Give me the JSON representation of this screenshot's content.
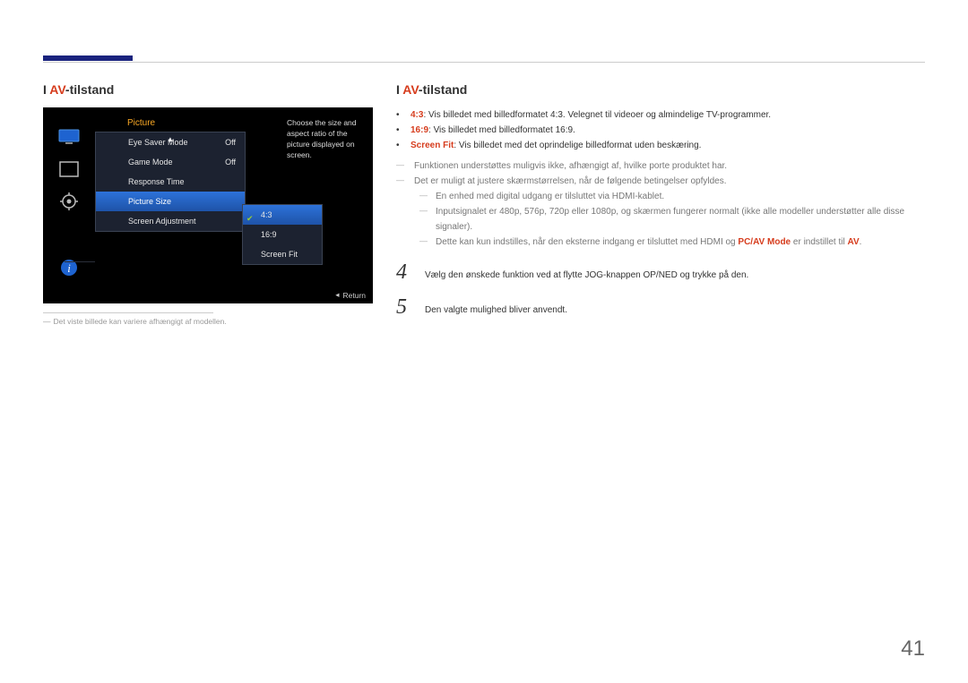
{
  "page_number": "41",
  "left": {
    "title_prefix": "I ",
    "title_accent": "AV",
    "title_suffix": "-tilstand",
    "caption": "Det viste billede kan variere afhængigt af modellen."
  },
  "osd": {
    "title": "Picture",
    "right_help": "Choose the size and aspect ratio of the picture displayed on screen.",
    "rows": [
      {
        "label": "Eye Saver Mode",
        "value": "Off"
      },
      {
        "label": "Game Mode",
        "value": "Off"
      },
      {
        "label": "Response Time",
        "value": ""
      },
      {
        "label": "Picture Size",
        "value": ""
      },
      {
        "label": "Screen Adjustment",
        "value": ""
      }
    ],
    "submenu": [
      {
        "label": "4:3",
        "selected": true
      },
      {
        "label": "16:9",
        "selected": false
      },
      {
        "label": "Screen Fit",
        "selected": false
      }
    ],
    "footer_return": "Return"
  },
  "right": {
    "title_prefix": "I ",
    "title_accent": "AV",
    "title_suffix": "-tilstand",
    "bullets": [
      {
        "label": "4:3",
        "desc": ": Vis billedet med billedformatet 4:3. Velegnet til videoer og almindelige TV-programmer."
      },
      {
        "label": "16:9",
        "desc": ": Vis billedet med billedformatet 16:9."
      },
      {
        "label": "Screen Fit",
        "desc": ": Vis billedet med det oprindelige billedformat uden beskæring."
      }
    ],
    "notes": {
      "n1": "Funktionen understøttes muligvis ikke, afhængigt af, hvilke porte produktet har.",
      "n2": "Det er muligt at justere skærmstørrelsen, når de følgende betingelser opfyldes.",
      "n2a": "En enhed med digital udgang er tilsluttet via HDMI-kablet.",
      "n2b": "Inputsignalet er 480p, 576p, 720p eller 1080p, og skærmen fungerer normalt (ikke alle modeller understøtter alle disse signaler).",
      "n2c_pre": "Dette kan kun indstilles, når den eksterne indgang er tilsluttet med HDMI og ",
      "n2c_bold1": "PC/AV Mode",
      "n2c_mid": " er indstillet til ",
      "n2c_bold2": "AV",
      "n2c_post": "."
    },
    "steps": [
      {
        "num": "4",
        "text": "Vælg den ønskede funktion ved at flytte JOG-knappen OP/NED og trykke på den."
      },
      {
        "num": "5",
        "text": "Den valgte mulighed bliver anvendt."
      }
    ]
  }
}
